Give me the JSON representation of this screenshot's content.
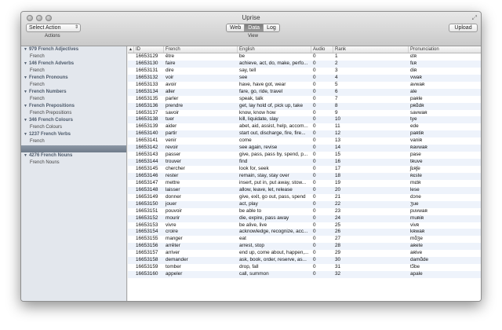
{
  "window": {
    "title": "Uprise"
  },
  "toolbar": {
    "select_action": "Select Action",
    "actions_label": "Actions",
    "view_label": "View",
    "view_tabs": [
      "Web",
      "Data",
      "Log"
    ],
    "active_tab": "Data",
    "upload_label": "Upload"
  },
  "sidebar": {
    "groups": [
      {
        "title": "979 French Adjectives",
        "items": [
          "French"
        ]
      },
      {
        "title": "146 French Adverbs",
        "items": [
          "French"
        ]
      },
      {
        "title": "French Pronouns",
        "items": [
          "French"
        ]
      },
      {
        "title": "French Numbers",
        "items": [
          "French"
        ]
      },
      {
        "title": "French Prepositions",
        "items": [
          "French Prepositions"
        ]
      },
      {
        "title": "346 French Colours",
        "items": [
          "French Colours"
        ]
      },
      {
        "title": "1237 French Verbs",
        "items": [
          "French"
        ]
      },
      {
        "title": "4276 French Nouns",
        "items": [
          "French Nouns"
        ]
      }
    ]
  },
  "table": {
    "columns": [
      "",
      "ID",
      "French",
      "English",
      "Audio",
      "Rank",
      "Pronunciation"
    ],
    "rows": [
      [
        "16653129",
        "être",
        "be",
        "0",
        "1",
        "ɛtʀ"
      ],
      [
        "16653130",
        "faire",
        "achieve, act, do, make, perfo...",
        "0",
        "2",
        "fɛʀ"
      ],
      [
        "16653131",
        "dire",
        "say, tell",
        "0",
        "3",
        "diʀ"
      ],
      [
        "16653132",
        "voir",
        "see",
        "0",
        "4",
        "vwaʀ"
      ],
      [
        "16653133",
        "avoir",
        "have, have got, wear",
        "0",
        "5",
        "avwaʀ"
      ],
      [
        "16653134",
        "aller",
        "fare, go, ride, travel",
        "0",
        "6",
        "ale"
      ],
      [
        "16653135",
        "parler",
        "speak, talk",
        "0",
        "7",
        "paʀle"
      ],
      [
        "16653136",
        "prendre",
        "get, lay hold of, pick up, take",
        "0",
        "8",
        "pʀɑ̃dʀ"
      ],
      [
        "16653137",
        "savoir",
        "know, know how",
        "0",
        "9",
        "savwaʀ"
      ],
      [
        "16653138",
        "tuer",
        "kill, liquidate, slay",
        "0",
        "10",
        "tye"
      ],
      [
        "16653139",
        "aider",
        "abet, aid, assist, help, accom...",
        "0",
        "11",
        "ede"
      ],
      [
        "16653140",
        "partir",
        "start out, discharge, fire, fire...",
        "0",
        "12",
        "paʀtiʀ"
      ],
      [
        "16653141",
        "venir",
        "come",
        "0",
        "13",
        "vaniʀ"
      ],
      [
        "16653142",
        "revoir",
        "see again, revise",
        "0",
        "14",
        "ʀavwaʀ"
      ],
      [
        "16653143",
        "passer",
        "give, pass, pass by, spend, p...",
        "0",
        "15",
        "pase"
      ],
      [
        "16653144",
        "trouver",
        "find",
        "0",
        "16",
        "tʀuve"
      ],
      [
        "16653145",
        "chercher",
        "look for, seek",
        "0",
        "17",
        "ʃɛʀʃe"
      ],
      [
        "16653146",
        "rester",
        "remain, stay, stay over",
        "0",
        "18",
        "ʀɛste"
      ],
      [
        "16653147",
        "mettre",
        "insert, put in, put away, stow...",
        "0",
        "19",
        "mɛtʀ"
      ],
      [
        "16653148",
        "laisser",
        "allow, leave, let, release",
        "0",
        "20",
        "lese"
      ],
      [
        "16653149",
        "donner",
        "give, exit, go out, pass, spend",
        "0",
        "21",
        "dɔne"
      ],
      [
        "16653150",
        "jouer",
        "act, play",
        "0",
        "22",
        "ʒue"
      ],
      [
        "16653151",
        "pouvoir",
        "be able to",
        "0",
        "23",
        "puvwaʀ"
      ],
      [
        "16653152",
        "mourir",
        "die, expire, pass away",
        "0",
        "24",
        "muʀiʀ"
      ],
      [
        "16653153",
        "vivre",
        "be alive, live",
        "0",
        "25",
        "vivʀ"
      ],
      [
        "16653154",
        "croire",
        "acknowledge, recognize, acc...",
        "0",
        "26",
        "kʀwaʀ"
      ],
      [
        "16653155",
        "manger",
        "eat",
        "0",
        "27",
        "mɑ̃ʒe"
      ],
      [
        "16653156",
        "arrêter",
        "arrest, stop",
        "0",
        "28",
        "aʀete"
      ],
      [
        "16653157",
        "arriver",
        "end up, come about, happen,...",
        "0",
        "29",
        "aʀive"
      ],
      [
        "16653158",
        "demander",
        "ask, book, order, reserve, as...",
        "0",
        "30",
        "damɑ̃de"
      ],
      [
        "16653159",
        "tomber",
        "drop, fall",
        "0",
        "31",
        "tɔ̃be"
      ],
      [
        "16653160",
        "appeler",
        "call, summon",
        "0",
        "32",
        "apale"
      ]
    ]
  }
}
